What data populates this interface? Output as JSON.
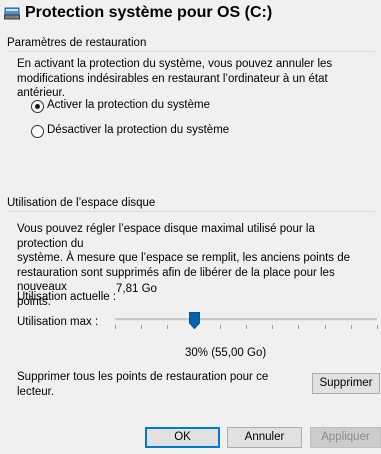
{
  "window": {
    "title": "Protection système pour OS (C:)"
  },
  "restore_settings": {
    "group_label": "Paramètres de restauration",
    "description_line1": "En activant la protection du système, vous pouvez annuler les",
    "description_line2": "modifications indésirables en restaurant l’ordinateur à un état antérieur.",
    "options": [
      {
        "label": "Activer la protection du système",
        "selected": true
      },
      {
        "label": "Désactiver la protection du système",
        "selected": false
      }
    ]
  },
  "disk_usage": {
    "group_label": "Utilisation de l’espace disque",
    "description_line1": "Vous pouvez régler l’espace disque maximal utilisé pour la protection du",
    "description_line2": "système. À mesure que l’espace se remplit, les anciens points de",
    "description_line3": "restauration sont supprimés afin de libérer de la place pour les nouveaux",
    "description_line4": "points.",
    "current_usage_label": "Utilisation actuelle :",
    "current_usage_value": "7,81 Go",
    "max_usage_label": "Utilisation max :",
    "max_usage_percent": 30,
    "max_usage_value": "30% (55,00 Go)"
  },
  "delete_points": {
    "text_line1": "Supprimer tous les points de restauration pour ce",
    "text_line2": "lecteur.",
    "button_label": "Supprimer"
  },
  "footer": {
    "ok_label": "OK",
    "cancel_label": "Annuler",
    "apply_label": "Appliquer"
  },
  "colors": {
    "background": "#f0f0f0",
    "accent": "#0078d7",
    "slider_thumb": "#0063b1"
  }
}
